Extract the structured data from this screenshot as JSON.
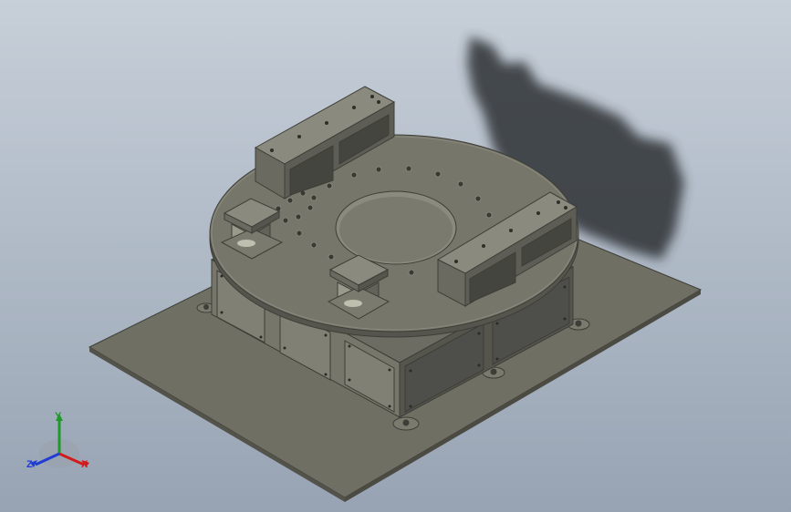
{
  "viewport": {
    "background_top": "#c7cfd8",
    "background_bottom": "#97a3b3"
  },
  "model": {
    "part_color": "#6f6f64",
    "part_light": "#8d8d80",
    "part_dark": "#4e4e47",
    "panel_dark": "#5a5a55",
    "shadow_color": "#2f3236",
    "components": [
      "base-plate",
      "housing",
      "turntable",
      "center-bore",
      "bolt-circle",
      "rail-block-back",
      "rail-block-front",
      "column-support-left",
      "column-support-front",
      "side-panels",
      "mounting-feet"
    ]
  },
  "triad": {
    "x_label": "X",
    "y_label": "Y",
    "z_label": "Z",
    "x_color": "#d21b1b",
    "y_color": "#1f9a2a",
    "z_color": "#1f3dd4"
  }
}
